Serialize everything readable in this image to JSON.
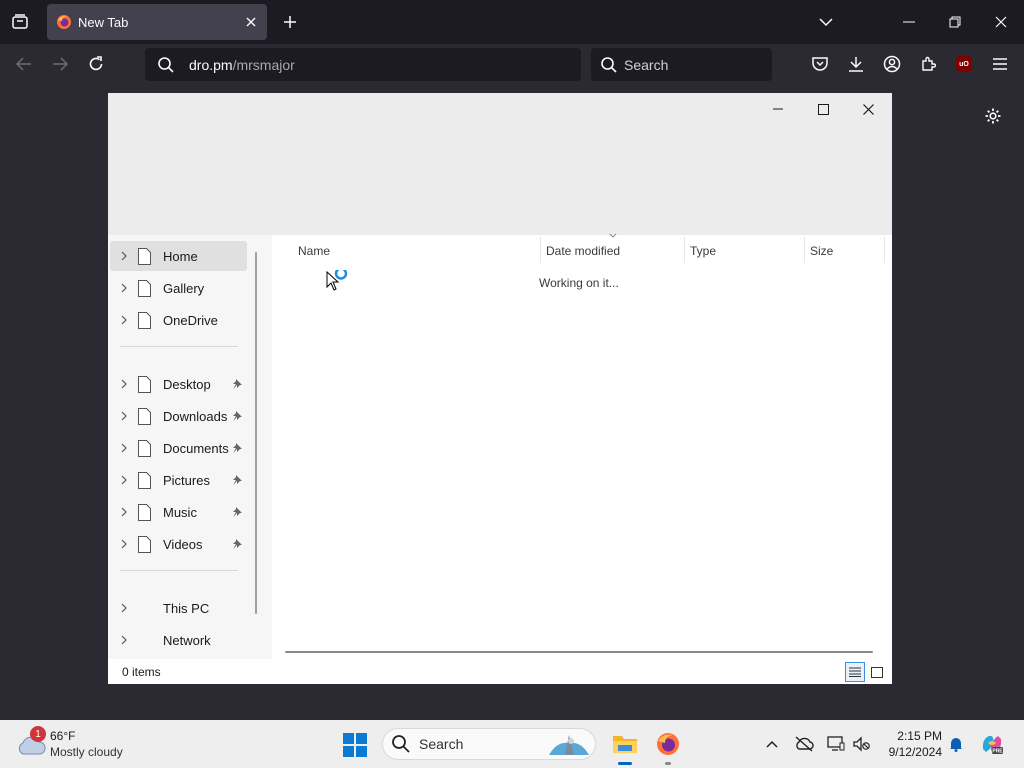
{
  "browser": {
    "tab_title": "New Tab",
    "url_host": "dro.pm",
    "url_path": "/mrsmajor",
    "search_placeholder": "Search"
  },
  "explorer": {
    "nav_items": [
      {
        "label": "Home",
        "selected": true,
        "pinned": false,
        "icon": "document-icon"
      },
      {
        "label": "Gallery",
        "selected": false,
        "pinned": false,
        "icon": "document-icon"
      },
      {
        "label": "OneDrive",
        "selected": false,
        "pinned": false,
        "icon": "document-icon"
      },
      {
        "label": "Desktop",
        "selected": false,
        "pinned": true,
        "icon": "document-icon"
      },
      {
        "label": "Downloads",
        "selected": false,
        "pinned": true,
        "icon": "document-icon"
      },
      {
        "label": "Documents",
        "selected": false,
        "pinned": true,
        "icon": "document-icon"
      },
      {
        "label": "Pictures",
        "selected": false,
        "pinned": true,
        "icon": "document-icon"
      },
      {
        "label": "Music",
        "selected": false,
        "pinned": true,
        "icon": "document-icon"
      },
      {
        "label": "Videos",
        "selected": false,
        "pinned": true,
        "icon": "document-icon"
      },
      {
        "label": "This PC",
        "selected": false,
        "pinned": false,
        "icon": ""
      },
      {
        "label": "Network",
        "selected": false,
        "pinned": false,
        "icon": ""
      }
    ],
    "columns": [
      "Name",
      "Date modified",
      "Type",
      "Size"
    ],
    "loading_text": "Working on it...",
    "status_count": "0 items"
  },
  "taskbar": {
    "weather_temp": "66°F",
    "weather_cond": "Mostly cloudy",
    "weather_badge": "1",
    "search_label": "Search",
    "time": "2:15 PM",
    "date": "9/12/2024"
  },
  "colors": {
    "accent": "#0067c0",
    "browser_bg": "#2b2a33",
    "tab_active": "#42414d"
  }
}
